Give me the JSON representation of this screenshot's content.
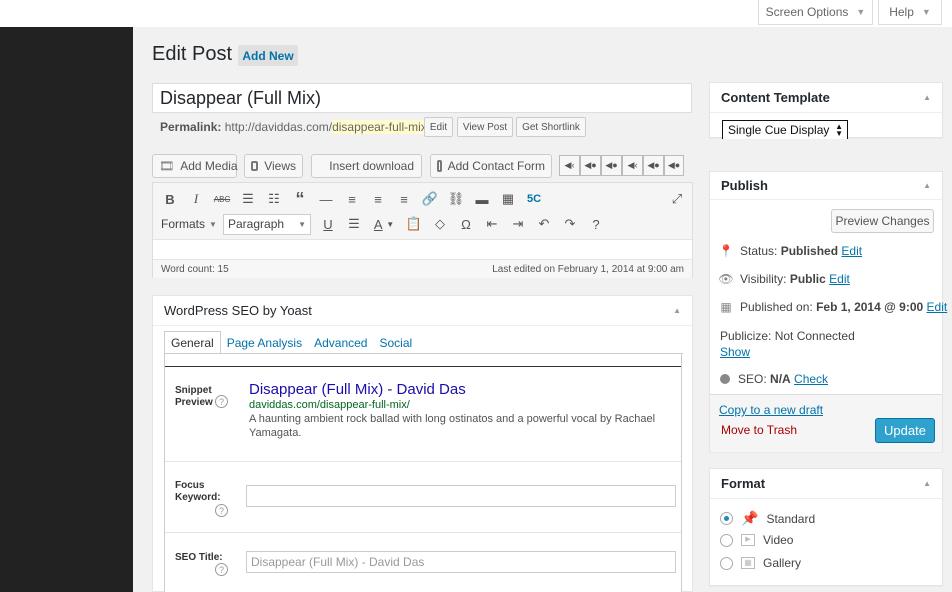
{
  "header": {
    "screen_options": "Screen Options",
    "help": "Help"
  },
  "page": {
    "title": "Edit Post",
    "add_new": "Add New"
  },
  "post": {
    "title": "Disappear (Full Mix)",
    "permalink_label": "Permalink:",
    "permalink_base": "http://daviddas.com/",
    "permalink_slug": "disappear-full-mix",
    "permalink_trail": "/",
    "edit_btn": "Edit",
    "view_btn": "View Post",
    "shortlink_btn": "Get Shortlink"
  },
  "media_buttons": {
    "add_media": "Add Media",
    "views": "Views",
    "insert_download": "Insert download",
    "add_contact_form": "Add Contact Form"
  },
  "editor": {
    "formats": "Formats",
    "paragraph": "Paragraph",
    "word_count": "Word count: 15",
    "last_edited": "Last edited on February 1, 2014 at 9:00 am"
  },
  "seo": {
    "box_title": "WordPress SEO by Yoast",
    "tabs": [
      "General",
      "Page Analysis",
      "Advanced",
      "Social"
    ],
    "snippet_label_1": "Snippet",
    "snippet_label_2": "Preview",
    "snippet_title": "Disappear (Full Mix) - David Das",
    "snippet_url": "daviddas.com/disappear-full-mix/",
    "snippet_desc": "A haunting ambient rock ballad with long ostinatos and a powerful vocal by Rachael Yamagata.",
    "focus_label_1": "Focus",
    "focus_label_2": "Keyword:",
    "focus_value": "",
    "seo_title_label": "SEO Title:",
    "seo_title_placeholder": "Disappear (Full Mix)  - David Das"
  },
  "content_template": {
    "title": "Content Template",
    "selected": "Single Cue Display"
  },
  "publish": {
    "title": "Publish",
    "preview_changes": "Preview Changes",
    "status_label": "Status:",
    "status_value": "Published",
    "visibility_label": "Visibility:",
    "visibility_value": "Public",
    "published_label": "Published on:",
    "published_value": "Feb 1, 2014 @ 9:00",
    "edit": "Edit",
    "publicize": "Publicize: Not Connected",
    "show": "Show",
    "seo_label": "SEO:",
    "seo_value": "N/A",
    "check": "Check",
    "copy_draft": "Copy to a new draft",
    "trash": "Move to Trash",
    "update": "Update"
  },
  "format": {
    "title": "Format",
    "options": [
      "Standard",
      "Video",
      "Gallery"
    ]
  },
  "colors": {
    "accent": "#0073aa",
    "update_button": "#2ea2cc",
    "trash": "#a00",
    "sidebar": "#222222"
  }
}
